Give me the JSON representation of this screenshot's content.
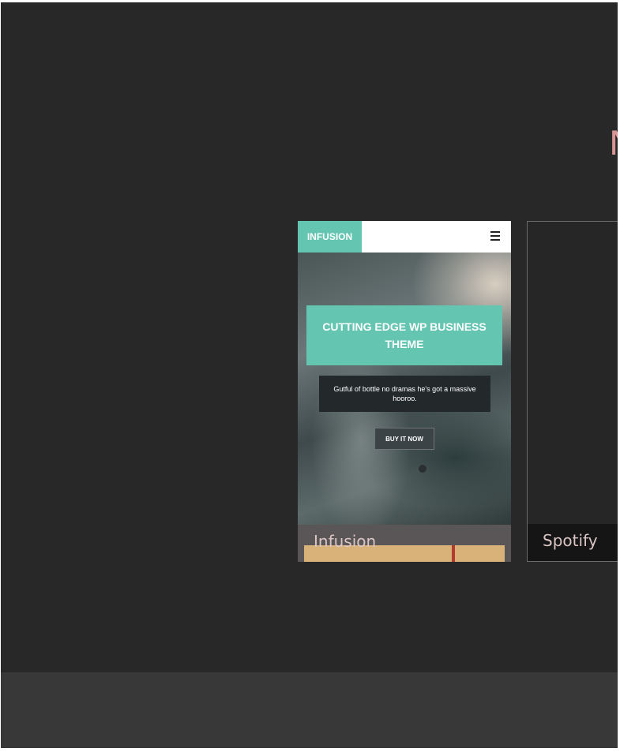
{
  "section": {
    "heading_partial": "N"
  },
  "cards": [
    {
      "caption": "Infusion",
      "preview": {
        "logo": "INFUSION",
        "menu_icon": "hamburger-icon",
        "hero_title": "CUTTING EDGE WP BUSINESS THEME",
        "hero_subtitle": "Gutful of bottle no dramas he's got a massive hooroo.",
        "cta_label": "BUY IT NOW"
      }
    },
    {
      "caption": "Spotify"
    }
  ],
  "colors": {
    "background": "#282828",
    "footer": "#383838",
    "accent": "#64c5b1",
    "caption_text": "#dbc5c5",
    "heading": "#d79595"
  }
}
